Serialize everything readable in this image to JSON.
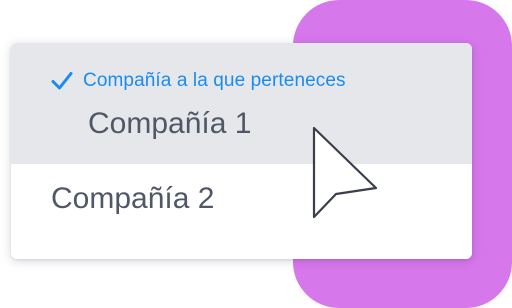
{
  "colors": {
    "accent": "#1a8cf0",
    "purple": "#d777ec",
    "selected_bg": "#e6e7ea",
    "text": "#505867"
  },
  "dropdown": {
    "group_label": "Compañía a la que perteneces",
    "selected_option": "Compañía 1",
    "options": [
      "Compañía 1",
      "Compañía 2"
    ]
  },
  "icons": {
    "check": "check-icon",
    "cursor": "mouse-pointer-icon"
  }
}
